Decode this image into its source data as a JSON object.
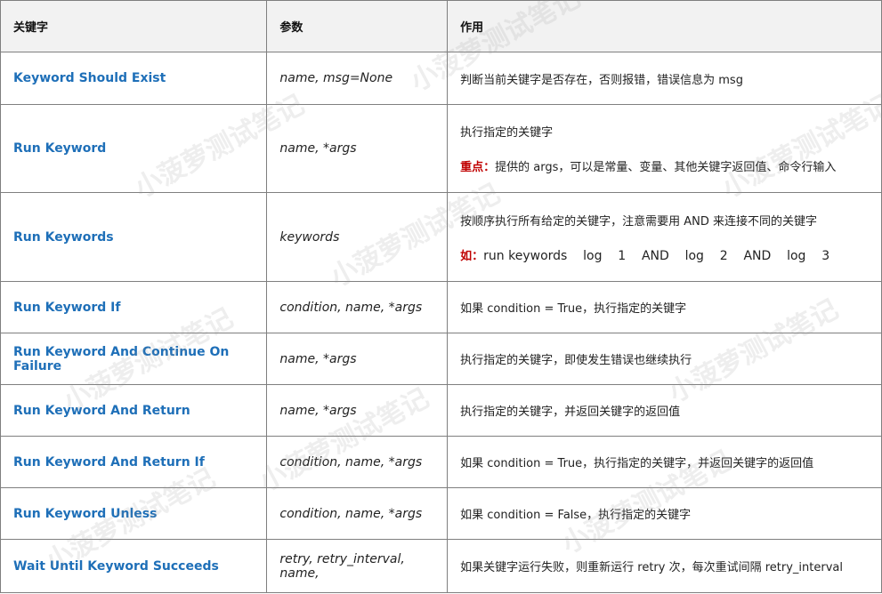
{
  "headers": [
    "关键字",
    "参数",
    "作用"
  ],
  "rows": [
    {
      "keyword": "Keyword Should  Exist",
      "args": "name, msg=None",
      "desc1": "判断当前关键字是否存在，否则报错，错误信息为  msg",
      "label": "",
      "desc2": ""
    },
    {
      "keyword": "Run Keyword",
      "args": "name, *args",
      "desc1": "执行指定的关键字",
      "label": "重点：",
      "desc2": "提供的 args，可以是常量、变量、其他关键字返回值、命令行输入"
    },
    {
      "keyword": "Run Keywords",
      "args": "keywords",
      "desc1": "按顺序执行所有给定的关键字，注意需要用  AND  来连接不同的关键字",
      "label": "如：",
      "desc2": "run keywords    log    1    AND    log    2    AND    log    3"
    },
    {
      "keyword": "Run Keyword If",
      "args": "condition, name, *args",
      "desc1": "如果 condition = True，执行指定的关键字",
      "label": "",
      "desc2": ""
    },
    {
      "keyword": "Run Keyword And Continue  On Failure",
      "args": "name, *args",
      "desc1": "执行指定的关键字，即使发生错误也继续执行",
      "label": "",
      "desc2": ""
    },
    {
      "keyword": "Run Keyword And Return",
      "args": "name, *args",
      "desc1": "执行指定的关键字，并返回关键字的返回值",
      "label": "",
      "desc2": ""
    },
    {
      "keyword": "Run Keyword And Return If",
      "args": "condition, name, *args",
      "desc1": "如果 condition = True，执行指定的关键字，并返回关键字的返回值",
      "label": "",
      "desc2": ""
    },
    {
      "keyword": "Run Keyword Unless",
      "args": "condition, name, *args",
      "desc1": "如果 condition = False，执行指定的关键字",
      "label": "",
      "desc2": ""
    },
    {
      "keyword": "Wait Until Keyword Succeeds",
      "args": "retry, retry_interval, name,",
      "desc1": "如果关键字运行失败，则重新运行  retry  次，每次重试间隔 retry_interval",
      "label": "",
      "desc2": ""
    }
  ],
  "watermark": "小菠萝测试笔记"
}
